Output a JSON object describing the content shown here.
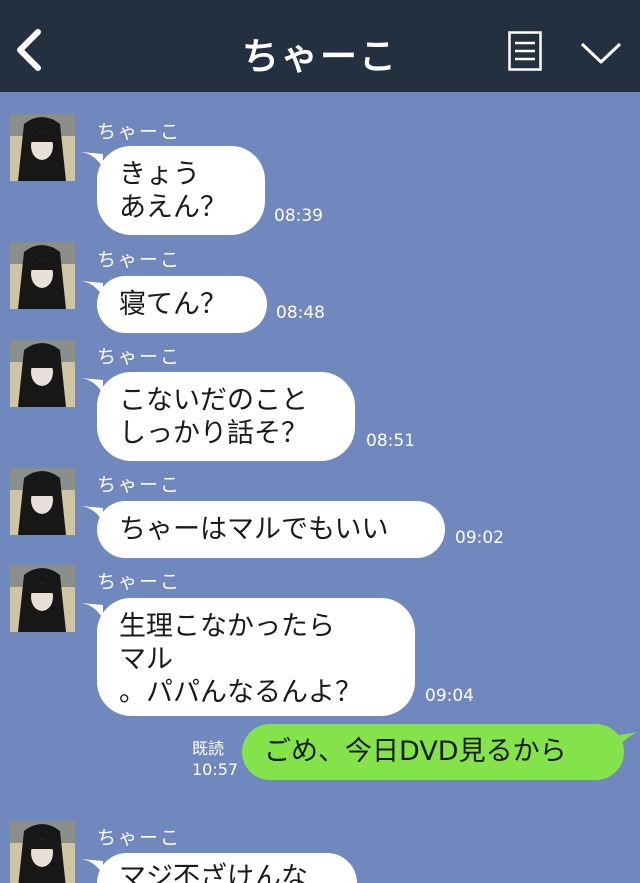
{
  "header": {
    "title": "ちゃーこ",
    "back_icon": "chevron-left-icon",
    "menu_icon": "list-icon",
    "collapse_icon": "chevron-down-icon",
    "bar_color": "#242f3f"
  },
  "chat": {
    "background_color": "#7088bd",
    "incoming": [
      {
        "sender": "ちゃーこ",
        "text": "きょう\nあえん？",
        "time": "08:39"
      },
      {
        "sender": "ちゃーこ",
        "text": "寝てん？",
        "time": "08:48"
      },
      {
        "sender": "ちゃーこ",
        "text": "こないだのこと\nしっかり話そ？",
        "time": "08:51"
      },
      {
        "sender": "ちゃーこ",
        "text": "ちゃーはマルでもいい",
        "time": "09:02"
      },
      {
        "sender": "ちゃーこ",
        "text": "生理こなかったら\nマル\n。パパんなるんよ？",
        "time": "09:04"
      },
      {
        "sender": "ちゃーこ",
        "text": "マジ不ざけんな",
        "time": ""
      }
    ],
    "outgoing": {
      "text": "ごめ、今日DVD見るから",
      "read_label": "既読",
      "time": "10:57",
      "bubble_color": "#84e24a"
    }
  }
}
